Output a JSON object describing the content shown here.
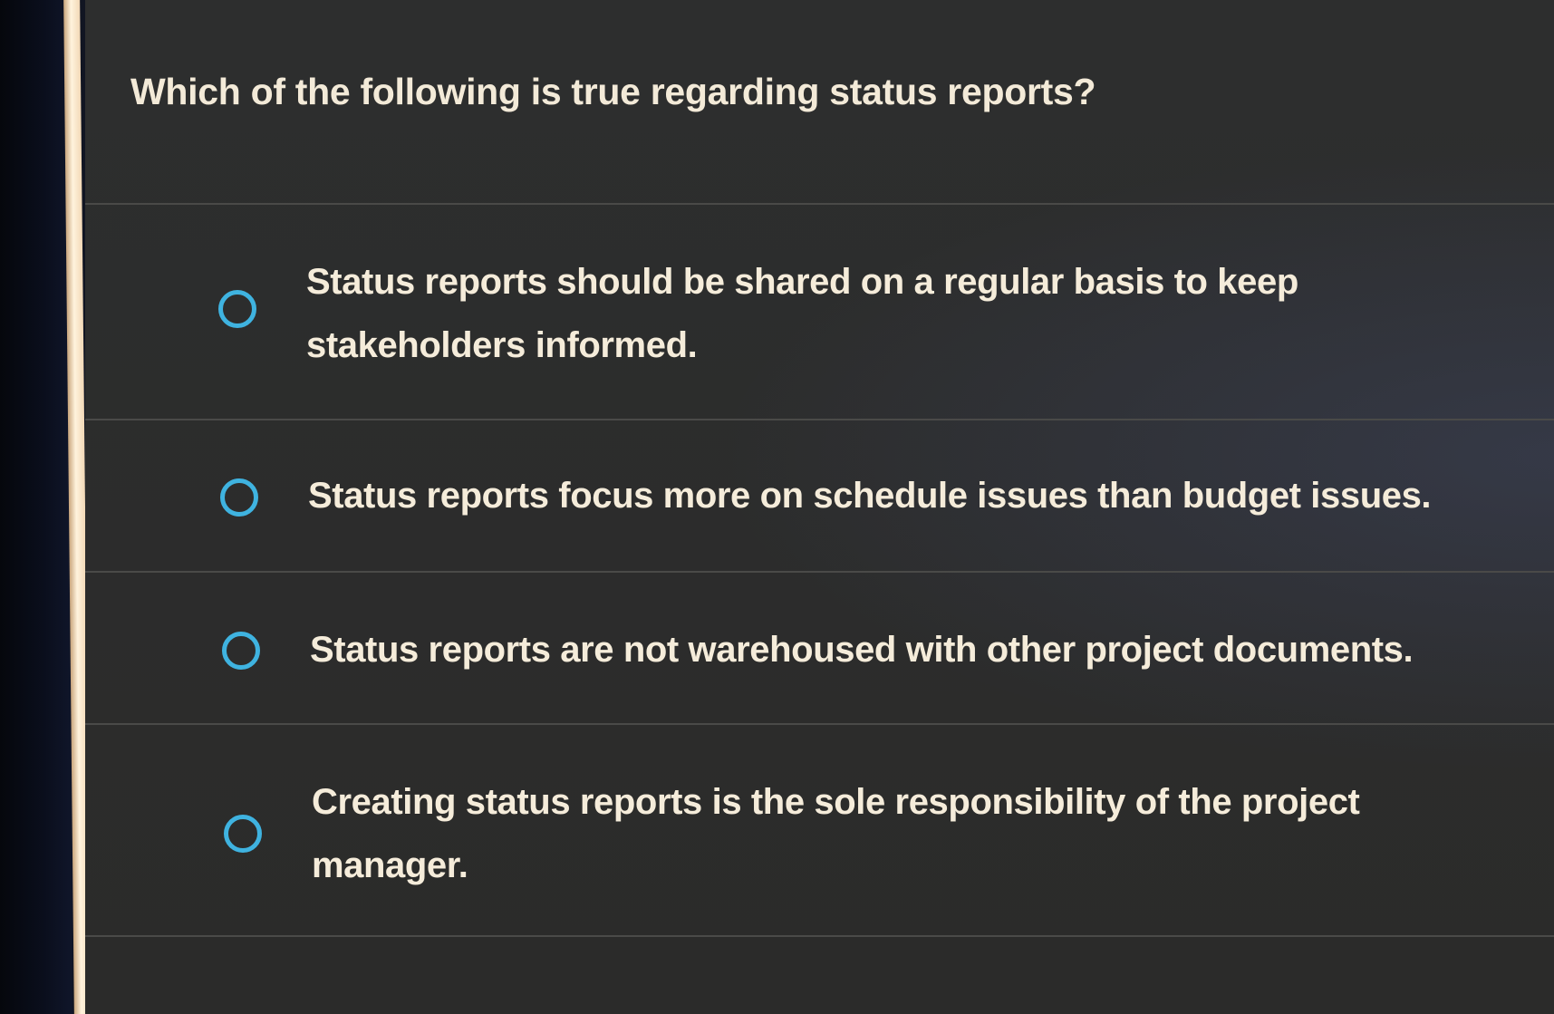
{
  "quiz": {
    "question": "Which of the following is true regarding status reports?",
    "options": [
      {
        "text": "Status reports should be shared on a regular basis to keep stakeholders informed.",
        "selected": false
      },
      {
        "text": "Status reports focus more on schedule issues than budget issues.",
        "selected": false
      },
      {
        "text": "Status reports are not warehoused with other project documents.",
        "selected": false
      },
      {
        "text": "Creating status reports is the sole responsibility of the project manager.",
        "selected": false
      }
    ]
  },
  "colors": {
    "panel_background": "#2c2c2b",
    "text": "#f5ecda",
    "radio_accent": "#3fb3e0",
    "left_accent_bar": "#f2d8b6"
  },
  "icons": {
    "radio": "radio-unselected-icon"
  }
}
